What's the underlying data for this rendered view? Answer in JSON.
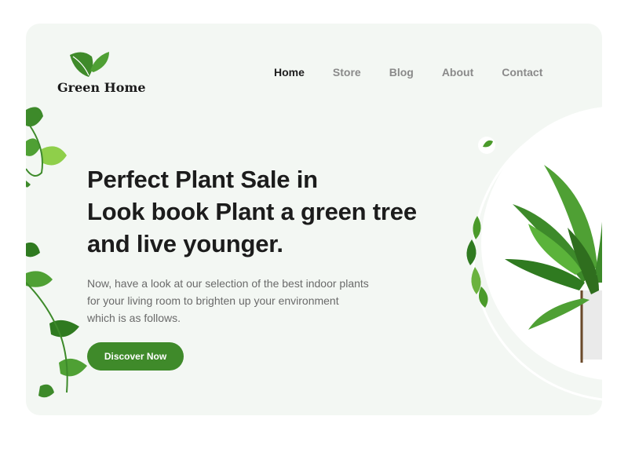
{
  "brand": {
    "name": "Green Home",
    "logo_icon": "leaf-icon",
    "accent_color": "#3f8a2a"
  },
  "nav": {
    "items": [
      {
        "label": "Home",
        "active": true
      },
      {
        "label": "Store",
        "active": false
      },
      {
        "label": "Blog",
        "active": false
      },
      {
        "label": "About",
        "active": false
      },
      {
        "label": "Contact",
        "active": false
      }
    ]
  },
  "hero": {
    "headline": [
      "Perfect Plant Sale in",
      "Look book Plant a green tree",
      "and live younger."
    ],
    "description": [
      "Now, have a look at our selection of the best indoor plants",
      "for your living room to brighten up your environment",
      "which is as follows."
    ],
    "cta_label": "Discover Now"
  },
  "colors": {
    "background": "#ffffff",
    "card": "#f3f7f3",
    "leaf_dark": "#2f6e1e",
    "leaf_light": "#8fcf4a"
  }
}
